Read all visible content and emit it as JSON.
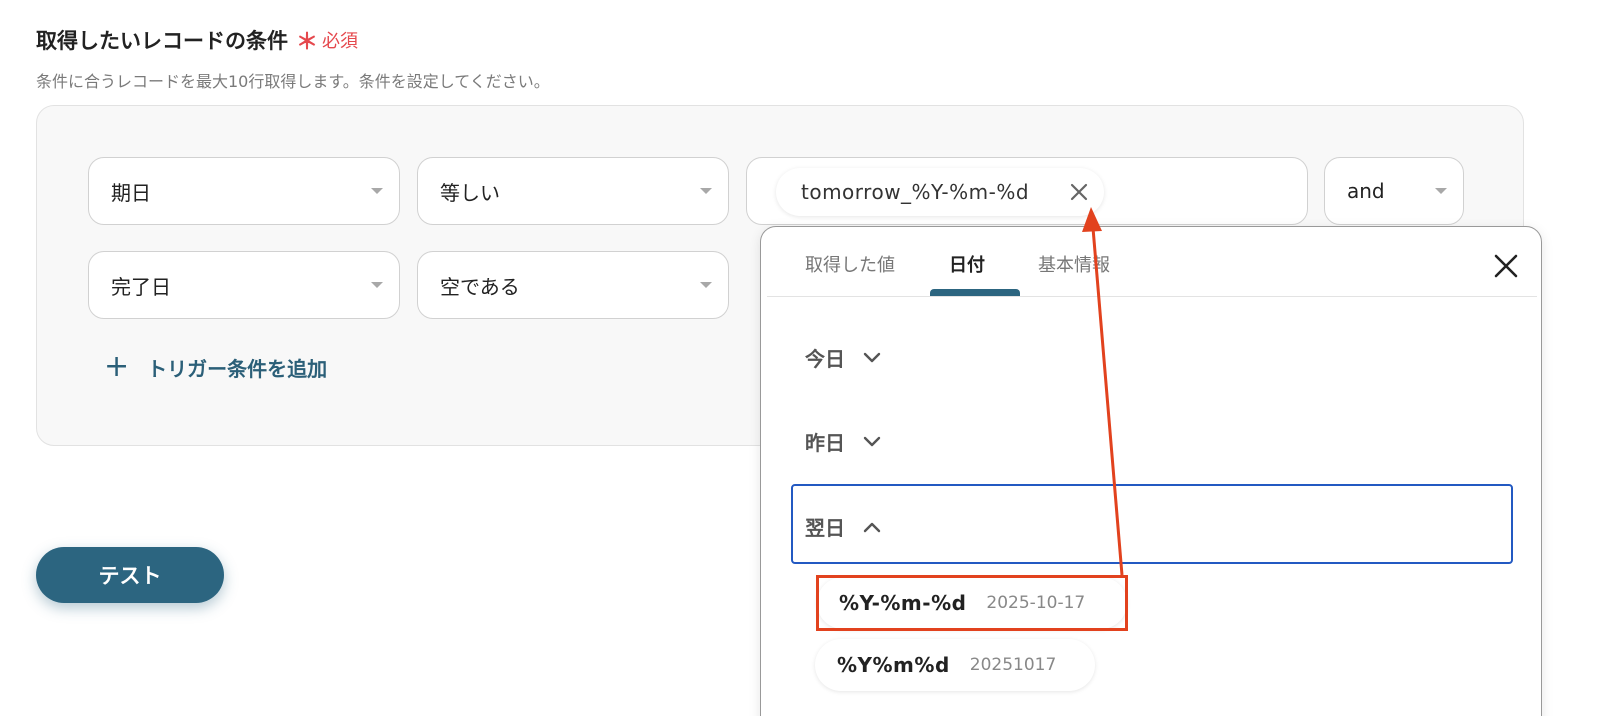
{
  "section": {
    "title": "取得したいレコードの条件",
    "required_star": "＊",
    "required_label": "必須",
    "description": "条件に合うレコードを最大10行取得します。条件を設定してください。"
  },
  "rows": [
    {
      "field": "期日",
      "operator": "等しい"
    },
    {
      "field": "完了日",
      "operator": "空である"
    }
  ],
  "value_chip": "tomorrow_%Y-%m-%d",
  "logic": "and",
  "add_condition_label": "トリガー条件を追加",
  "test_button": "テスト",
  "popup": {
    "tabs": [
      "取得した値",
      "日付",
      "基本情報"
    ],
    "active_tab": "日付",
    "sections": [
      {
        "label": "今日",
        "expanded": false
      },
      {
        "label": "昨日",
        "expanded": false
      },
      {
        "label": "翌日",
        "expanded": true
      }
    ],
    "formats": [
      {
        "code": "%Y-%m-%d",
        "example": "2025-10-17"
      },
      {
        "code": "%Y%m%d",
        "example": "20251017"
      }
    ]
  },
  "colors": {
    "primary": "#2c6580",
    "required": "#e5484d",
    "annotation": "#e2421e",
    "focus": "#2359c2"
  }
}
